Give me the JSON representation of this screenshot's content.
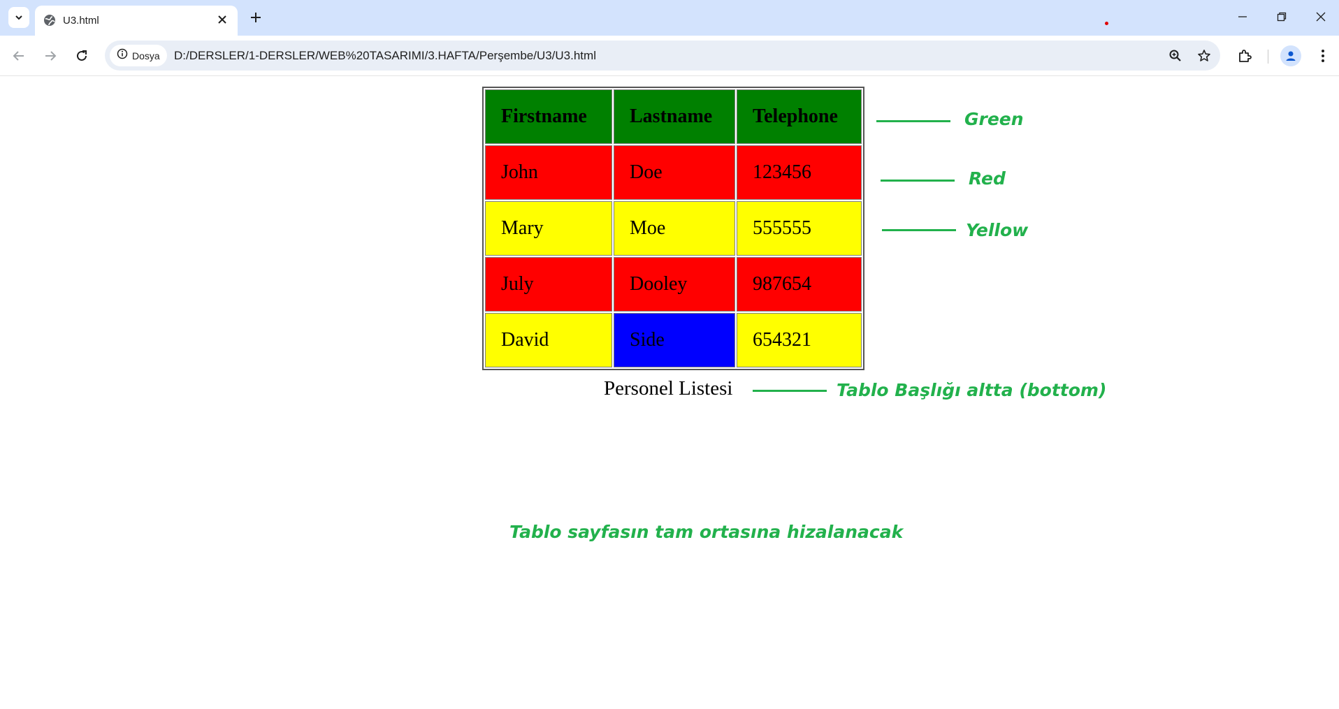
{
  "browser": {
    "tab": {
      "title": "U3.html"
    },
    "address": {
      "site_label": "Dosya",
      "url": "D:/DERSLER/1-DERSLER/WEB%20TASARIMI/3.HAFTA/Perşembe/U3/U3.html"
    }
  },
  "table": {
    "headers": [
      "Firstname",
      "Lastname",
      "Telephone"
    ],
    "rows": [
      {
        "cells": [
          "John",
          "Doe",
          "123456"
        ],
        "colors": [
          "#ff0000",
          "#ff0000",
          "#ff0000"
        ]
      },
      {
        "cells": [
          "Mary",
          "Moe",
          "555555"
        ],
        "colors": [
          "#ffff00",
          "#ffff00",
          "#ffff00"
        ]
      },
      {
        "cells": [
          "July",
          "Dooley",
          "987654"
        ],
        "colors": [
          "#ff0000",
          "#ff0000",
          "#ff0000"
        ]
      },
      {
        "cells": [
          "David",
          "Side",
          "654321"
        ],
        "colors": [
          "#ffff00",
          "#0000ff",
          "#ffff00"
        ]
      }
    ],
    "header_color": "#008000",
    "caption": "Personel Listesi"
  },
  "annotations": {
    "color": "#22b14c",
    "green": "Green",
    "red": "Red",
    "yellow": "Yellow",
    "caption_note": "Tablo Başlığı altta (bottom)",
    "center_note": "Tablo sayfasın tam ortasına hizalanacak"
  }
}
